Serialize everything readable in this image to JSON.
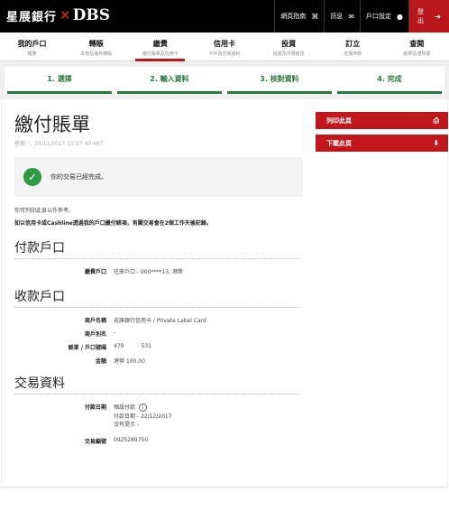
{
  "brand": {
    "name_cn": "星展銀行",
    "name_en": "DBS"
  },
  "top_links": [
    {
      "label": "網頁指南",
      "icon": "sitemap-icon"
    },
    {
      "label": "訊息",
      "icon": "mail-icon"
    },
    {
      "label": "戶口設定",
      "icon": "user-icon"
    }
  ],
  "logout_label": "登出",
  "nav": [
    {
      "title": "我的戶口",
      "sub": "概覽"
    },
    {
      "title": "轉賬",
      "sub": "本地及海外轉賬"
    },
    {
      "title": "繳費",
      "sub": "繳付賬單及信用卡"
    },
    {
      "title": "信用卡",
      "sub": "卡戶及交易資料"
    },
    {
      "title": "投資",
      "sub": "投資及市場資訊"
    },
    {
      "title": "訂立",
      "sub": "定期存款"
    },
    {
      "title": "查閱",
      "sub": "結單及通知書"
    }
  ],
  "steps": [
    "1. 選擇",
    "2. 輸入資料",
    "3. 核對資料",
    "4. 完成"
  ],
  "page_title": "繳付賬單",
  "page_date": "星期一, 20/11/2017 11:57:40 HKT",
  "actions": {
    "print": "列印此頁",
    "download": "下載此頁"
  },
  "success_message": "你的交易已經完成。",
  "notes": {
    "line1": "你可列印此頁以作參考。",
    "line2": "如以信用卡或Cashline透過我的戶口繳付賬項，有關交易會在2個工作天後記錄。"
  },
  "sections": {
    "payment_account": {
      "title": "付款戶口",
      "rows": [
        {
          "label": "繳費戶口",
          "value": "往來戶口 - 000****13, 港幣"
        }
      ]
    },
    "payee_account": {
      "title": "收款戶口",
      "rows": [
        {
          "label": "商戶名稱",
          "value": "花旗銀行信用卡 / Private Label Card"
        },
        {
          "label": "商戶別名",
          "value": "-"
        },
        {
          "label": "賬單 / 戶口號碼",
          "value": "479          531"
        },
        {
          "label": "金額",
          "value": "港幣 100.00"
        }
      ]
    },
    "transaction": {
      "title": "交易資料",
      "pay_date_label": "付款日期",
      "pay_date_value1": "預設付款",
      "pay_date_value2": "付款日期 - 22/12/2017",
      "pay_date_value3": "沒有提示 -",
      "ref_label": "交易編號",
      "ref_value": "0925289750"
    }
  },
  "colors": {
    "brand_red": "#c0171d",
    "step_green": "#2a7a3b",
    "success_green": "#2f9a45"
  }
}
